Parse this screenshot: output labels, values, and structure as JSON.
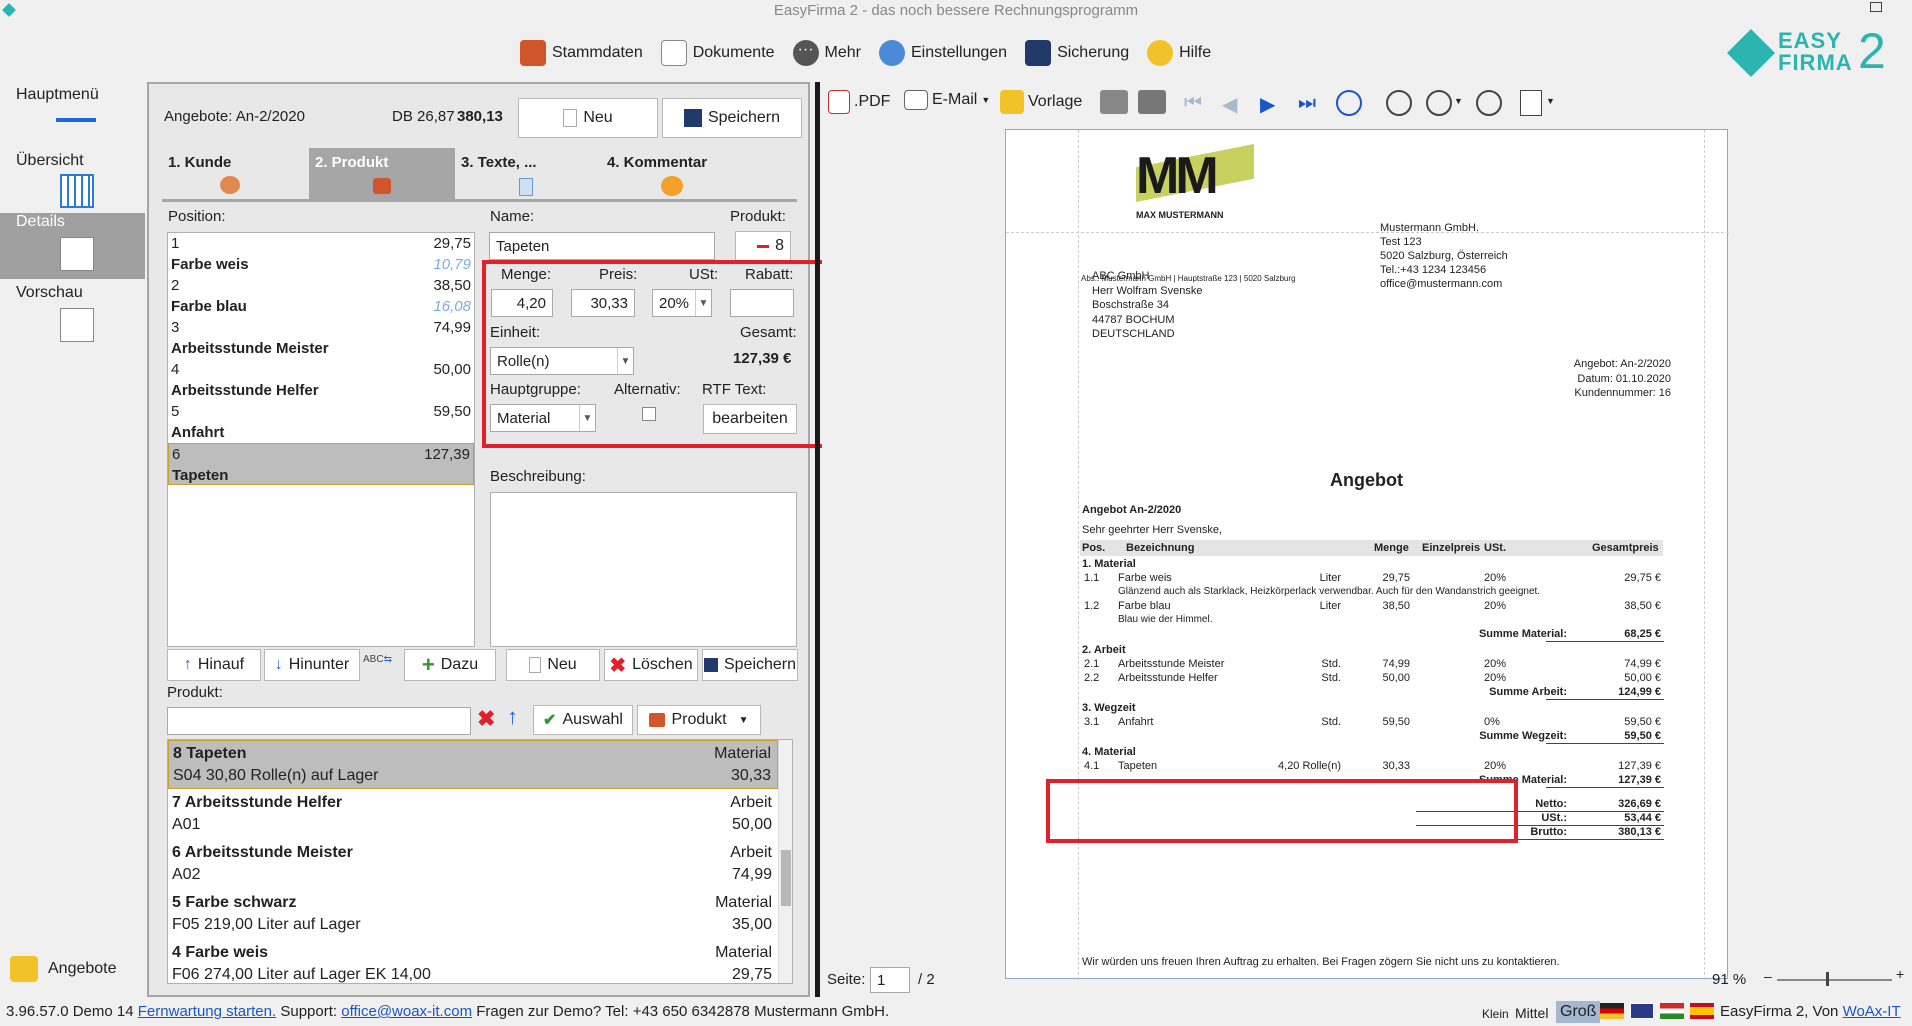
{
  "window": {
    "title": "EasyFirma 2 - das noch bessere Rechnungsprogramm"
  },
  "menu": [
    "Stammdaten",
    "Dokumente",
    "Mehr",
    "Einstellungen",
    "Sicherung",
    "Hilfe"
  ],
  "logo": {
    "line1": "EASY",
    "line2": "FIRMA",
    "num": "2"
  },
  "nav": {
    "hauptmenu": "Hauptmenü",
    "ubersicht": "Übersicht",
    "details": "Details",
    "vorschau": "Vorschau",
    "angebote": "Angebote"
  },
  "header": {
    "title": "Angebote: An-2/2020",
    "db_label": "DB 26,87",
    "total": "380,13",
    "neu": "Neu",
    "speichern": "Speichern"
  },
  "tabs": [
    "1. Kunde",
    "2. Produkt",
    "3. Texte, ...",
    "4. Kommentar"
  ],
  "labels": {
    "position": "Position:",
    "name": "Name:",
    "produkt": "Produkt:",
    "menge": "Menge:",
    "preis": "Preis:",
    "ust": "USt:",
    "rabatt": "Rabatt:",
    "einheit": "Einheit:",
    "gesamt": "Gesamt:",
    "hauptgruppe": "Hauptgruppe:",
    "alternativ": "Alternativ:",
    "rtf": "RTF Text:",
    "beschreibung": "Beschreibung:",
    "produkt2": "Produkt:"
  },
  "positions": [
    {
      "n": "1",
      "v": "29,75",
      "t": "Farbe weis",
      "v2": "10,79"
    },
    {
      "n": "2",
      "v": "38,50",
      "t": "Farbe blau",
      "v2": "16,08"
    },
    {
      "n": "3",
      "v": "74,99",
      "t": "Arbeitsstunde Meister",
      "v2": ""
    },
    {
      "n": "4",
      "v": "50,00",
      "t": "Arbeitsstunde Helfer",
      "v2": ""
    },
    {
      "n": "5",
      "v": "59,50",
      "t": "Anfahrt",
      "v2": ""
    },
    {
      "n": "6",
      "v": "127,39",
      "t": "Tapeten",
      "v2": ""
    }
  ],
  "form": {
    "name": "Tapeten",
    "produkt_no": "8",
    "menge": "4,20",
    "preis": "30,33",
    "ust": "20%",
    "rabatt": "",
    "einheit": "Rolle(n)",
    "gesamt": "127,39 €",
    "hauptgruppe": "Material",
    "bearbeiten": "bearbeiten"
  },
  "actions": {
    "hinauf": "Hinauf",
    "hinunter": "Hinunter",
    "dazu": "Dazu",
    "neu": "Neu",
    "loeschen": "Löschen",
    "speichern": "Speichern",
    "auswahl": "Auswahl",
    "produkt": "Produkt"
  },
  "products": [
    {
      "a": "8 Tapeten",
      "b": "Material",
      "c": "S04 30,80 Rolle(n) auf Lager",
      "d": "30,33"
    },
    {
      "a": "7 Arbeitsstunde Helfer",
      "b": "Arbeit",
      "c": "A01",
      "d": "50,00"
    },
    {
      "a": "6 Arbeitsstunde Meister",
      "b": "Arbeit",
      "c": "A02",
      "d": "74,99"
    },
    {
      "a": "5 Farbe schwarz",
      "b": "Material",
      "c": "F05 219,00 Liter auf Lager",
      "d": "35,00"
    },
    {
      "a": "4 Farbe weis",
      "b": "Material",
      "c": "F06 274,00 Liter auf Lager EK 14,00",
      "d": "29,75"
    }
  ],
  "toolbar": {
    "pdf": ".PDF",
    "email": "E-Mail",
    "vorlage": "Vorlage"
  },
  "doc": {
    "logo_sub": "MAX MUSTERMANN",
    "sender": [
      "Mustermann GmbH.",
      "Test 123",
      "5020 Salzburg, Österreich",
      "Tel.:+43 1234 123456",
      "office@mustermann.com"
    ],
    "abs": "Abs.: Mustermann GmbH | Hauptstraße 123 | 5020 Salzburg",
    "recipient": [
      "ABC GmbH",
      "Herr Wolfram Svenske",
      "Boschstraße 34",
      "44787 BOCHUM",
      "DEUTSCHLAND"
    ],
    "meta": [
      "Angebot: An-2/2020",
      "Datum: 01.10.2020",
      "Kundennummer: 16"
    ],
    "heading": "Angebot",
    "subheading": "Angebot An-2/2020",
    "salutation": "Sehr geehrter Herr Svenske,",
    "cols": {
      "pos": "Pos.",
      "bez": "Bezeichnung",
      "menge": "Menge",
      "ep": "Einzelpreis",
      "ust": "USt.",
      "gp": "Gesamtpreis"
    },
    "g1": "1. Material",
    "r11": {
      "p": "1.1",
      "b": "Farbe weis",
      "m": "Liter",
      "e": "29,75",
      "u": "20%",
      "g": "29,75 €"
    },
    "r11d": "Glänzend auch als Starklack, Heizkörperlack verwendbar. Auch für den Wandanstrich geeignet.",
    "r12": {
      "p": "1.2",
      "b": "Farbe blau",
      "m": "Liter",
      "e": "38,50",
      "u": "20%",
      "g": "38,50 €"
    },
    "r12d": "Blau wie der Himmel.",
    "s1": {
      "l": "Summe Material:",
      "v": "68,25 €"
    },
    "g2": "2. Arbeit",
    "r21": {
      "p": "2.1",
      "b": "Arbeitsstunde Meister",
      "m": "Std.",
      "e": "74,99",
      "u": "20%",
      "g": "74,99 €"
    },
    "r22": {
      "p": "2.2",
      "b": "Arbeitsstunde Helfer",
      "m": "Std.",
      "e": "50,00",
      "u": "20%",
      "g": "50,00 €"
    },
    "s2": {
      "l": "Summe Arbeit:",
      "v": "124,99 €"
    },
    "g3": "3. Wegzeit",
    "r31": {
      "p": "3.1",
      "b": "Anfahrt",
      "m": "Std.",
      "e": "59,50",
      "u": "0%",
      "g": "59,50 €"
    },
    "s3": {
      "l": "Summe Wegzeit:",
      "v": "59,50 €"
    },
    "g4": "4. Material",
    "r41": {
      "p": "4.1",
      "b": "Tapeten",
      "m": "4,20 Rolle(n)",
      "e": "30,33",
      "u": "20%",
      "g": "127,39 €"
    },
    "s4": {
      "l": "Summe Material:",
      "v": "127,39 €"
    },
    "netto": {
      "l": "Netto:",
      "v": "326,69 €"
    },
    "ustt": {
      "l": "USt.:",
      "v": "53,44 €"
    },
    "brutto": {
      "l": "Brutto:",
      "v": "380,13 €"
    },
    "footer": "Wir würden uns freuen Ihren Auftrag zu erhalten. Bei Fragen zögern Sie nicht uns zu kontaktieren."
  },
  "pager": {
    "label": "Seite:",
    "page": "1",
    "total": "/ 2",
    "zoom": "91 %"
  },
  "status": {
    "version": "3.96.57.0 Demo 14",
    "fern": "Fernwartung starten.",
    "support": "Support:",
    "email": "office@woax-it.com",
    "demo": "Fragen zur Demo? Tel: +43 650 6342878",
    "company": "Mustermann GmbH.",
    "klein": "Klein",
    "mittel": "Mittel",
    "gross": "Groß",
    "product": "EasyFirma 2, Von",
    "woax": "WoAx-IT"
  },
  "colors": {
    "accent": "#1a56c8",
    "red": "#e0202a",
    "selected": "#a6a6a6",
    "logo": "#2bb5b0"
  }
}
